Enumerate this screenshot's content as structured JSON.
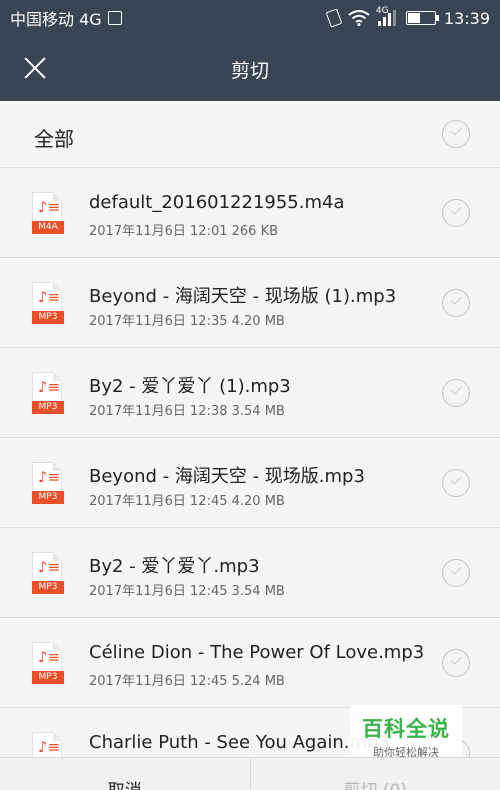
{
  "status_bar": {
    "carrier": "中国移动 4G",
    "network": "4G",
    "time": "13:39",
    "battery_level": 0.45
  },
  "header": {
    "title": "剪切"
  },
  "select_all": {
    "label": "全部"
  },
  "files": [
    {
      "name": "default_201601221955.m4a",
      "meta": "2017年11月6日 12:01 266 KB",
      "type": "M4A"
    },
    {
      "name": "Beyond - 海阔天空 - 现场版 (1).mp3",
      "meta": "2017年11月6日 12:35 4.20 MB",
      "type": "MP3"
    },
    {
      "name": "By2 - 爱丫爱丫 (1).mp3",
      "meta": "2017年11月6日 12:38 3.54 MB",
      "type": "MP3"
    },
    {
      "name": "Beyond - 海阔天空 - 现场版.mp3",
      "meta": "2017年11月6日 12:45 4.20 MB",
      "type": "MP3"
    },
    {
      "name": "By2 - 爱丫爱丫.mp3",
      "meta": "2017年11月6日 12:45 3.54 MB",
      "type": "MP3"
    },
    {
      "name": "Céline Dion - The Power Of Love.mp3",
      "meta": "2017年11月6日 12:45 5.24 MB",
      "type": "MP3"
    },
    {
      "name": "Charlie Puth - See You Again.mp3",
      "meta": "",
      "type": "MP3"
    }
  ],
  "footer": {
    "cancel_label": "取消",
    "cut_label": "剪切 (0)"
  },
  "watermark": {
    "title": "百科全说",
    "subtitle": "助你轻松解决"
  }
}
